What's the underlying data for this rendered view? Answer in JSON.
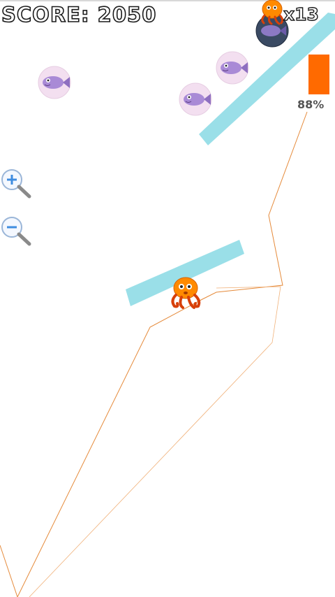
{
  "hud": {
    "score_label": "SCORE:",
    "score_value": "2050",
    "lives_text": "x13",
    "power_percent_text": "88%",
    "power_fraction": 0.88,
    "accent_color": "#ff6a00"
  },
  "icons": {
    "zoom_in": "zoom-in-icon",
    "zoom_out": "zoom-out-icon",
    "octopus": "octopus-icon",
    "fish": "fish-bubble-icon"
  },
  "colors": {
    "platform": "#8fdbe6",
    "trajectory": "#e58a3a",
    "octopus": "#ff8a00",
    "fish_body": "#a98ad6",
    "bubble": "#f3dff0"
  }
}
